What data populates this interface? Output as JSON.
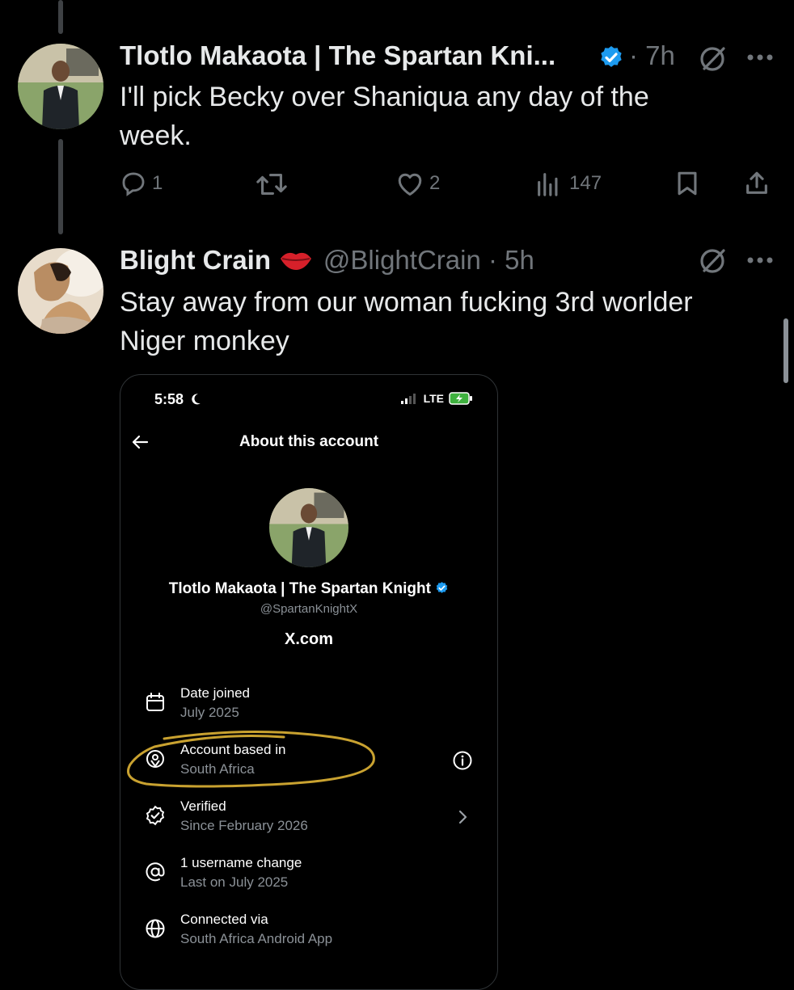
{
  "tweets": [
    {
      "display_name": "Tlotlo Makaota | The Spartan Kni...",
      "verified": true,
      "meta": "· 7h",
      "text": "I'll pick Becky over Shaniqua any day of the week.",
      "actions": {
        "replies": "1",
        "retweets": "",
        "likes": "2",
        "views": "147"
      }
    },
    {
      "display_name": "Blight Crain",
      "handle_meta": "@BlightCrain · 5h",
      "text": "Stay away from our woman fucking 3rd worlder Niger monkey"
    }
  ],
  "embedded_screenshot": {
    "status_time": "5:58",
    "status_network": "LTE",
    "title": "About this account",
    "profile_name": "Tlotlo Makaota | The Spartan Knight",
    "profile_handle": "@SpartanKnightX",
    "profile_link": "X.com",
    "rows": [
      {
        "label": "Date joined",
        "value": "July 2025",
        "icon": "calendar-icon"
      },
      {
        "label": "Account based in",
        "value": "South Africa",
        "icon": "location-pin-icon"
      },
      {
        "label": "Verified",
        "value": "Since February 2026",
        "icon": "verified-badge-icon"
      },
      {
        "label": "1 username change",
        "value": "Last on July 2025",
        "icon": "at-sign-icon"
      },
      {
        "label": "Connected via",
        "value": "South Africa Android App",
        "icon": "globe-icon"
      }
    ]
  },
  "colors": {
    "background": "#000000",
    "text_primary": "#e7e9ea",
    "text_secondary": "#71767b",
    "verified_blue": "#1d9bf0",
    "annotation_circle": "#c9a230"
  }
}
